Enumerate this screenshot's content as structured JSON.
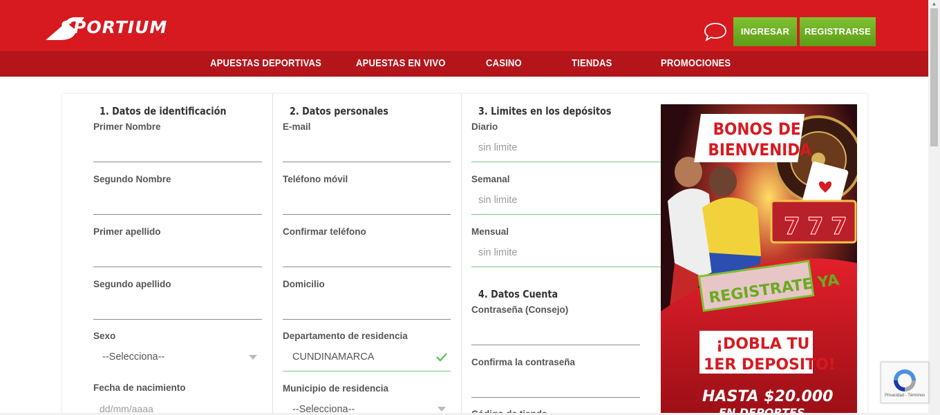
{
  "header": {
    "logo_text": "SPORTIUM",
    "login_label": "INGRESAR",
    "register_label": "REGISTRARSE",
    "brand_color": "#d71920",
    "accent_green": "#6aab21"
  },
  "nav": {
    "items": [
      {
        "label": "APUESTAS DEPORTIVAS"
      },
      {
        "label": "APUESTAS EN VIVO"
      },
      {
        "label": "CASINO"
      },
      {
        "label": "TIENDAS"
      },
      {
        "label": "PROMOCIONES"
      }
    ]
  },
  "form": {
    "section1": {
      "title": "1. Datos de identificación",
      "first_name_label": "Primer Nombre",
      "second_name_label": "Segundo Nombre",
      "first_surname_label": "Primer apellido",
      "second_surname_label": "Segundo apellido",
      "sex_label": "Sexo",
      "sex_value": "--Selecciona--",
      "birthdate_label": "Fecha de nacimiento",
      "birthdate_placeholder": "dd/mm/aaaa"
    },
    "section2": {
      "title": "2. Datos personales",
      "email_label": "E-mail",
      "phone_label": "Teléfono móvil",
      "confirm_phone_label": "Confirmar teléfono",
      "address_label": "Domicilio",
      "department_label": "Departamento de residencia",
      "department_value": "CUNDINAMARCA",
      "municipality_label": "Municipio de residencia",
      "municipality_value": "--Selecciona--"
    },
    "section3": {
      "title": "3. Limites en los depósitos",
      "daily_label": "Diario",
      "daily_placeholder": "sin limite",
      "weekly_label": "Semanal",
      "weekly_placeholder": "sin limite",
      "monthly_label": "Mensual",
      "monthly_placeholder": "sin limite"
    },
    "section4": {
      "title": "4. Datos Cuenta",
      "password_label": "Contraseña (Consejo)",
      "confirm_password_label": "Confirma la contraseña",
      "store_code_label": "Código de tienda"
    }
  },
  "banner": {
    "headline_1": "BONOS DE",
    "headline_2": "BIENVENIDA",
    "cta": "REGISTRATE YA",
    "offer_1": "¡DOBLA TU",
    "offer_2": "1ER DEPOSITO!",
    "amount_1": "HASTA $20.000",
    "amount_2": "EN DEPORTES"
  },
  "recaptcha": {
    "footer": "Privacidad - Términos"
  }
}
